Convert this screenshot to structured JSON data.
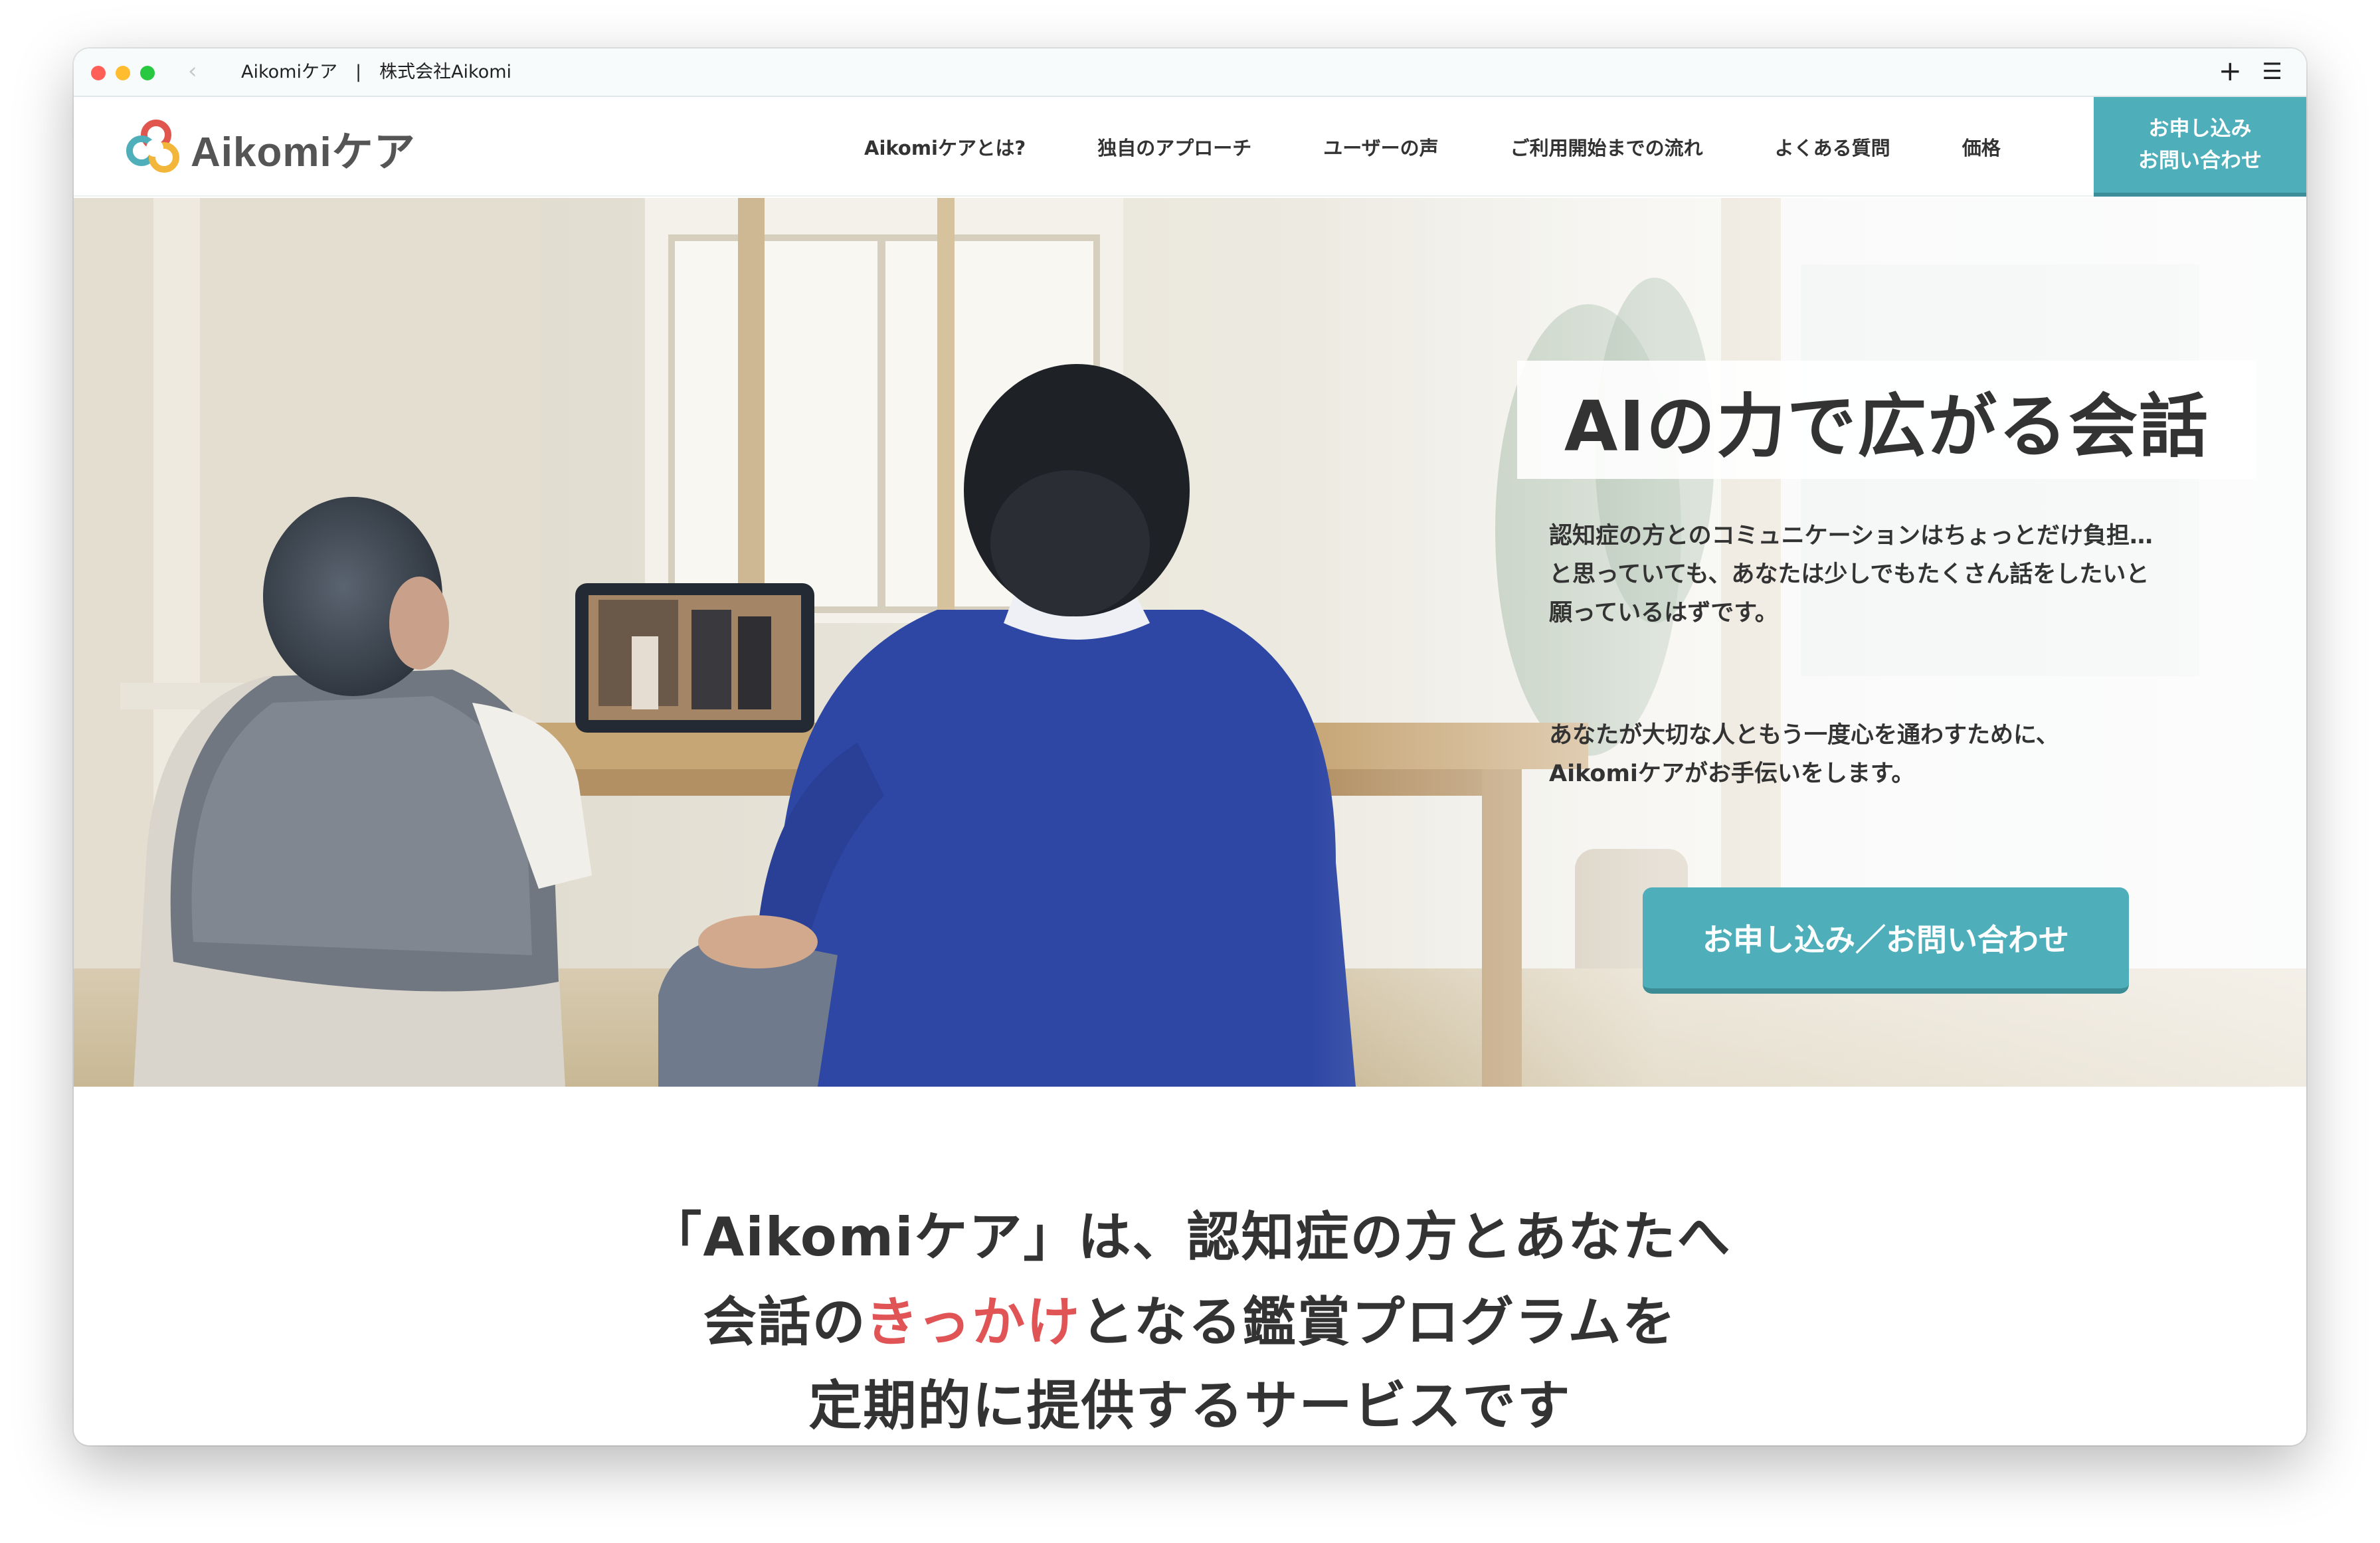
{
  "browser": {
    "tab_title": "Aikomiケア　|　株式会社Aikomi"
  },
  "header": {
    "logo_text": "Aikomiケア",
    "nav": [
      {
        "label": "Aikomiケアとは?"
      },
      {
        "label": "独自のアプローチ"
      },
      {
        "label": "ユーザーの声"
      },
      {
        "label": "ご利用開始までの流れ"
      },
      {
        "label": "よくある質問"
      },
      {
        "label": "価格"
      }
    ],
    "cta": {
      "line1": "お申し込み",
      "line2": "お問い合わせ"
    }
  },
  "hero": {
    "title": "AIの力で広がる会話",
    "paragraph1": [
      "認知症の方とのコミュニケーションはちょっとだけ負担…",
      "と思っていても、あなたは少しでもたくさん話をしたいと",
      "願っているはずです。"
    ],
    "paragraph2": [
      "あなたが大切な人ともう一度心を通わすために、",
      "Aikomiケアがお手伝いをします。"
    ],
    "cta": "お申し込み／お問い合わせ"
  },
  "lead": {
    "line1": "「Aikomiケア」は、認知症の方とあなたへ",
    "line2_before": "会話の",
    "line2_accent": "きっかけ",
    "line2_after": "となる鑑賞プログラムを",
    "line3": "定期的に提供するサービスです"
  },
  "colors": {
    "primary": "#4eafba",
    "accent": "#e05456",
    "text": "#333333"
  },
  "icons": {
    "back": "chevron-left-icon",
    "new_tab": "plus-icon",
    "menu": "hamburger-menu-icon",
    "logo": "cloud-logo-icon"
  }
}
